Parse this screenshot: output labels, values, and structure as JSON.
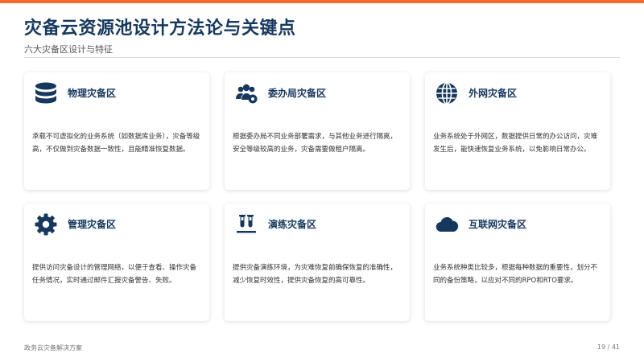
{
  "header": {
    "title": "灾备云资源池设计方法论与关键点",
    "subtitle": "六大灾备区设计与特征"
  },
  "accent_color": "#f26b2a",
  "title_color": "#17385e",
  "cards": [
    {
      "icon": "database-icon",
      "title": "物理灾备区",
      "description": "承载不可虚拟化的业务系统（如数据库业务），灾备等级高，不仅做到灾备数据一致性，且能精准恢复数据。"
    },
    {
      "icon": "users-cog-icon",
      "title": "委办局灾备区",
      "description": "根据委办局不同业务部署需求，与其他业务进行隔离，安全等级较高的业务，灾备需要做租户隔离。"
    },
    {
      "icon": "globe-icon",
      "title": "外网灾备区",
      "description": "业务系统处于外网区，数据提供日常的办公访问，灾难发生后，能快速恢复业务系统，以免影响日常办公。"
    },
    {
      "icon": "gear-icon",
      "title": "管理灾备区",
      "description": "提供访问灾备设计的管理网络，以便于查看、操作灾备任务情况，实时通过邮件汇报灾备警告、失败。"
    },
    {
      "icon": "test-tubes-icon",
      "title": "演练灾备区",
      "description": "提供灾备演练环境，为灾难恢复前确保恢复的准确性，减少恢复时效性，提供灾备恢复的高可靠性。"
    },
    {
      "icon": "cloud-icon",
      "title": "互联网灾备区",
      "description": "业务系统种类比较多，根据每种数据的重要性，划分不同的备份策略，以应对不同的RPO和RTO要求。"
    }
  ],
  "footer": {
    "left": "政务云灾备解决方案",
    "page": "19 / 41"
  }
}
